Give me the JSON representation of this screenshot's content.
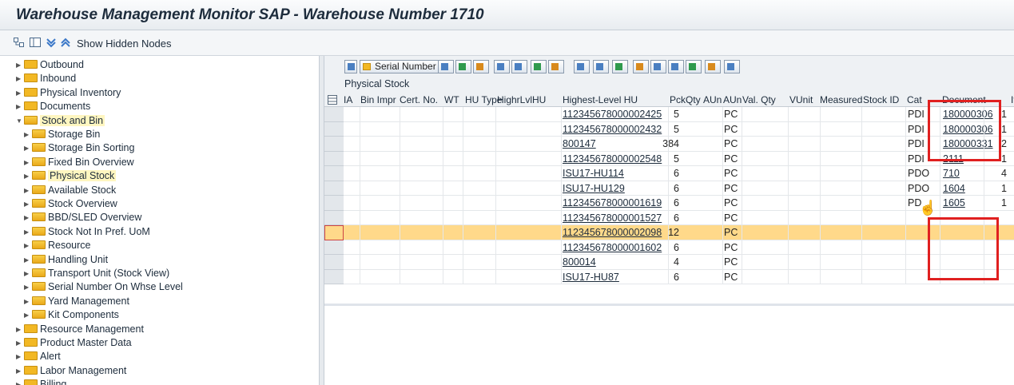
{
  "window": {
    "title": "Warehouse Management Monitor SAP - Warehouse Number 1710"
  },
  "toolbar": {
    "show_hidden_nodes": "Show Hidden Nodes"
  },
  "tree": {
    "items": [
      {
        "label": "Outbound",
        "level": 0,
        "open": false,
        "highlight": false
      },
      {
        "label": "Inbound",
        "level": 0,
        "open": false,
        "highlight": false
      },
      {
        "label": "Physical Inventory",
        "level": 0,
        "open": false,
        "highlight": false
      },
      {
        "label": "Documents",
        "level": 0,
        "open": false,
        "highlight": false
      },
      {
        "label": "Stock and Bin",
        "level": 0,
        "open": true,
        "highlight": true
      },
      {
        "label": "Storage Bin",
        "level": 1,
        "open": false,
        "highlight": false
      },
      {
        "label": "Storage Bin Sorting",
        "level": 1,
        "open": false,
        "highlight": false
      },
      {
        "label": "Fixed Bin Overview",
        "level": 1,
        "open": false,
        "highlight": false
      },
      {
        "label": "Physical Stock",
        "level": 1,
        "open": false,
        "highlight": true
      },
      {
        "label": "Available Stock",
        "level": 1,
        "open": false,
        "highlight": false
      },
      {
        "label": "Stock Overview",
        "level": 1,
        "open": false,
        "highlight": false
      },
      {
        "label": "BBD/SLED Overview",
        "level": 1,
        "open": false,
        "highlight": false
      },
      {
        "label": "Stock Not In Pref. UoM",
        "level": 1,
        "open": false,
        "highlight": false
      },
      {
        "label": "Resource",
        "level": 1,
        "open": false,
        "highlight": false
      },
      {
        "label": "Handling Unit",
        "level": 1,
        "open": false,
        "highlight": false
      },
      {
        "label": "Transport Unit  (Stock View)",
        "level": 1,
        "open": false,
        "highlight": false
      },
      {
        "label": "Serial Number On Whse Level",
        "level": 1,
        "open": false,
        "highlight": false
      },
      {
        "label": "Yard Management",
        "level": 1,
        "open": false,
        "highlight": false
      },
      {
        "label": "Kit Components",
        "level": 1,
        "open": false,
        "highlight": false
      },
      {
        "label": "Resource Management",
        "level": 0,
        "open": false,
        "highlight": false
      },
      {
        "label": "Product Master Data",
        "level": 0,
        "open": false,
        "highlight": false
      },
      {
        "label": "Alert",
        "level": 0,
        "open": false,
        "highlight": false
      },
      {
        "label": "Labor Management",
        "level": 0,
        "open": false,
        "highlight": false
      },
      {
        "label": "Billing",
        "level": 0,
        "open": false,
        "highlight": false
      }
    ]
  },
  "alv": {
    "serial_button": "Serial Number",
    "grid_title": "Physical Stock",
    "headers": [
      "IA",
      "Bin Impr",
      "Cert. No.",
      "WT",
      "HU Type",
      "HighrLvlHU",
      "Highest-Level HU",
      "PckQty",
      "AUn",
      "AUn",
      "Val. Qty",
      "VUnit",
      "Measured",
      "Stock ID",
      "Cat",
      "Document",
      "Item"
    ],
    "rows": [
      {
        "hu": "112345678000002425",
        "qty": "5",
        "aun": "PC",
        "cat": "PDI",
        "doc": "180000306",
        "item": "1"
      },
      {
        "hu": "112345678000002432",
        "qty": "5",
        "aun": "PC",
        "cat": "PDI",
        "doc": "180000306",
        "item": "1"
      },
      {
        "hu": "800147",
        "qty": "384",
        "aun": "PC",
        "cat": "PDI",
        "doc": "180000331",
        "item": "2"
      },
      {
        "hu": "112345678000002548",
        "qty": "5",
        "aun": "PC",
        "cat": "PDI",
        "doc": "2111",
        "item": "1"
      },
      {
        "hu": "ISU17-HU114",
        "qty": "6",
        "aun": "PC",
        "cat": "PDO",
        "doc": "710",
        "item": "4"
      },
      {
        "hu": "ISU17-HU129",
        "qty": "6",
        "aun": "PC",
        "cat": "PDO",
        "doc": "1604",
        "item": "1"
      },
      {
        "hu": "112345678000001619",
        "qty": "6",
        "aun": "PC",
        "cat": "PD",
        "doc": "1605",
        "item": "1"
      },
      {
        "hu": "112345678000001527",
        "qty": "6",
        "aun": "PC",
        "cat": "",
        "doc": "",
        "item": ""
      },
      {
        "hu": "112345678000002098",
        "qty": "12",
        "aun": "PC",
        "cat": "",
        "doc": "",
        "item": ""
      },
      {
        "hu": "112345678000001602",
        "qty": "6",
        "aun": "PC",
        "cat": "",
        "doc": "",
        "item": ""
      },
      {
        "hu": "800014",
        "qty": "4",
        "aun": "PC",
        "cat": "",
        "doc": "",
        "item": ""
      },
      {
        "hu": "ISU17-HU87",
        "qty": "6",
        "aun": "PC",
        "cat": "",
        "doc": "",
        "item": ""
      }
    ],
    "selected_row": 8
  },
  "colors": {
    "highlight": "#fff6c0",
    "selected_row": "#ffd98a",
    "annotation_red": "#e02020"
  }
}
